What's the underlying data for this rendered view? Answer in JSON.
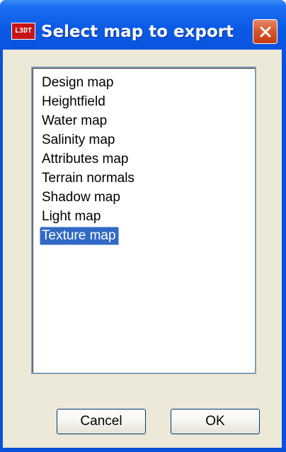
{
  "window": {
    "title": "Select map to export",
    "app_icon_text": "L3DT",
    "close_icon": "close-icon"
  },
  "list": {
    "items": [
      "Design map",
      "Heightfield",
      "Water map",
      "Salinity map",
      "Attributes map",
      "Terrain normals",
      "Shadow map",
      "Light map",
      "Texture map"
    ],
    "selected": "Texture map"
  },
  "buttons": {
    "cancel": "Cancel",
    "ok": "OK"
  },
  "colors": {
    "title_bar": "#0a5ae6",
    "close_button": "#d9582e",
    "selection": "#316ac5",
    "dialog_face": "#ece9d8"
  }
}
